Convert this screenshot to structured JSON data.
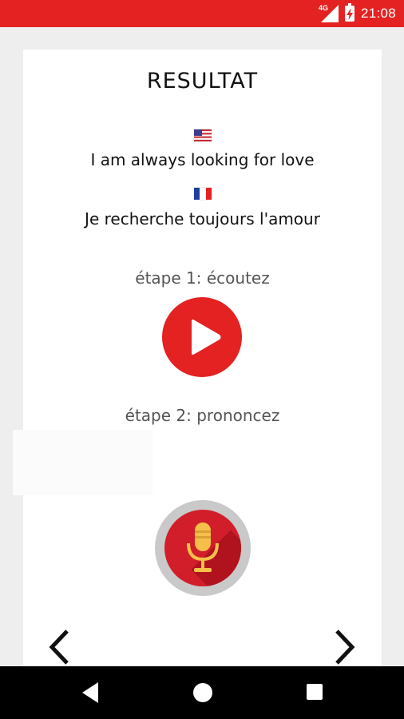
{
  "status_bar": {
    "time": "21:08",
    "network": "4G",
    "icons": [
      "signal-icon",
      "battery-charging-icon"
    ],
    "background": "#e42222"
  },
  "result": {
    "title": "RESULTAT",
    "source_flag": "us-flag-icon",
    "source_text": "I am always looking for love",
    "target_flag": "france-flag-icon",
    "target_text": "Je recherche toujours l'amour"
  },
  "steps": {
    "step1_label": "étape 1: écoutez",
    "step2_label": "étape 2: prononcez"
  },
  "controls": {
    "play_icon": "play-icon",
    "mic_icon": "microphone-icon",
    "prev_icon": "chevron-left-icon",
    "next_icon": "chevron-right-icon"
  },
  "nav_bar": {
    "icons": [
      "back-icon",
      "home-icon",
      "recent-apps-icon"
    ]
  },
  "colors": {
    "accent": "#e42222",
    "mic_red": "#d11e2a",
    "mic_gold": "#f5c04a"
  }
}
